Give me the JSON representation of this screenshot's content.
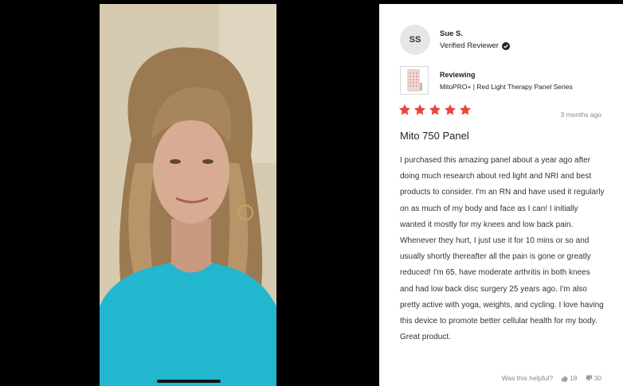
{
  "reviewer": {
    "initials": "SS",
    "name": "Sue S.",
    "badge": "Verified Reviewer"
  },
  "product": {
    "label": "Reviewing",
    "name": "MitoPRO+ | Red Light Therapy Panel Series"
  },
  "review": {
    "rating": 5,
    "date": "3 months ago",
    "title": "Mito 750 Panel",
    "body": "I purchased this amazing panel about a year ago after doing much research about red light and NRI and best products to consider. I'm an RN and have used it regularly on as much of my body and face as I can! I initially wanted it mostly for my knees and low back pain. Whenever they hurt, I just use it for 10 mins or so and usually shortly thereafter all the pain is gone or greatly reduced! I'm 65, have moderate arthritis in both knees and had low back disc surgery 25 years ago. I'm also pretty active with yoga, weights, and cycling. I love having this device to promote better cellular health for my body. Great product."
  },
  "helpful": {
    "label": "Was this helpful?",
    "up": "18",
    "down": "30"
  },
  "colors": {
    "star": "#e8453c",
    "verified": "#222222",
    "shirt": "#22b7cf"
  }
}
